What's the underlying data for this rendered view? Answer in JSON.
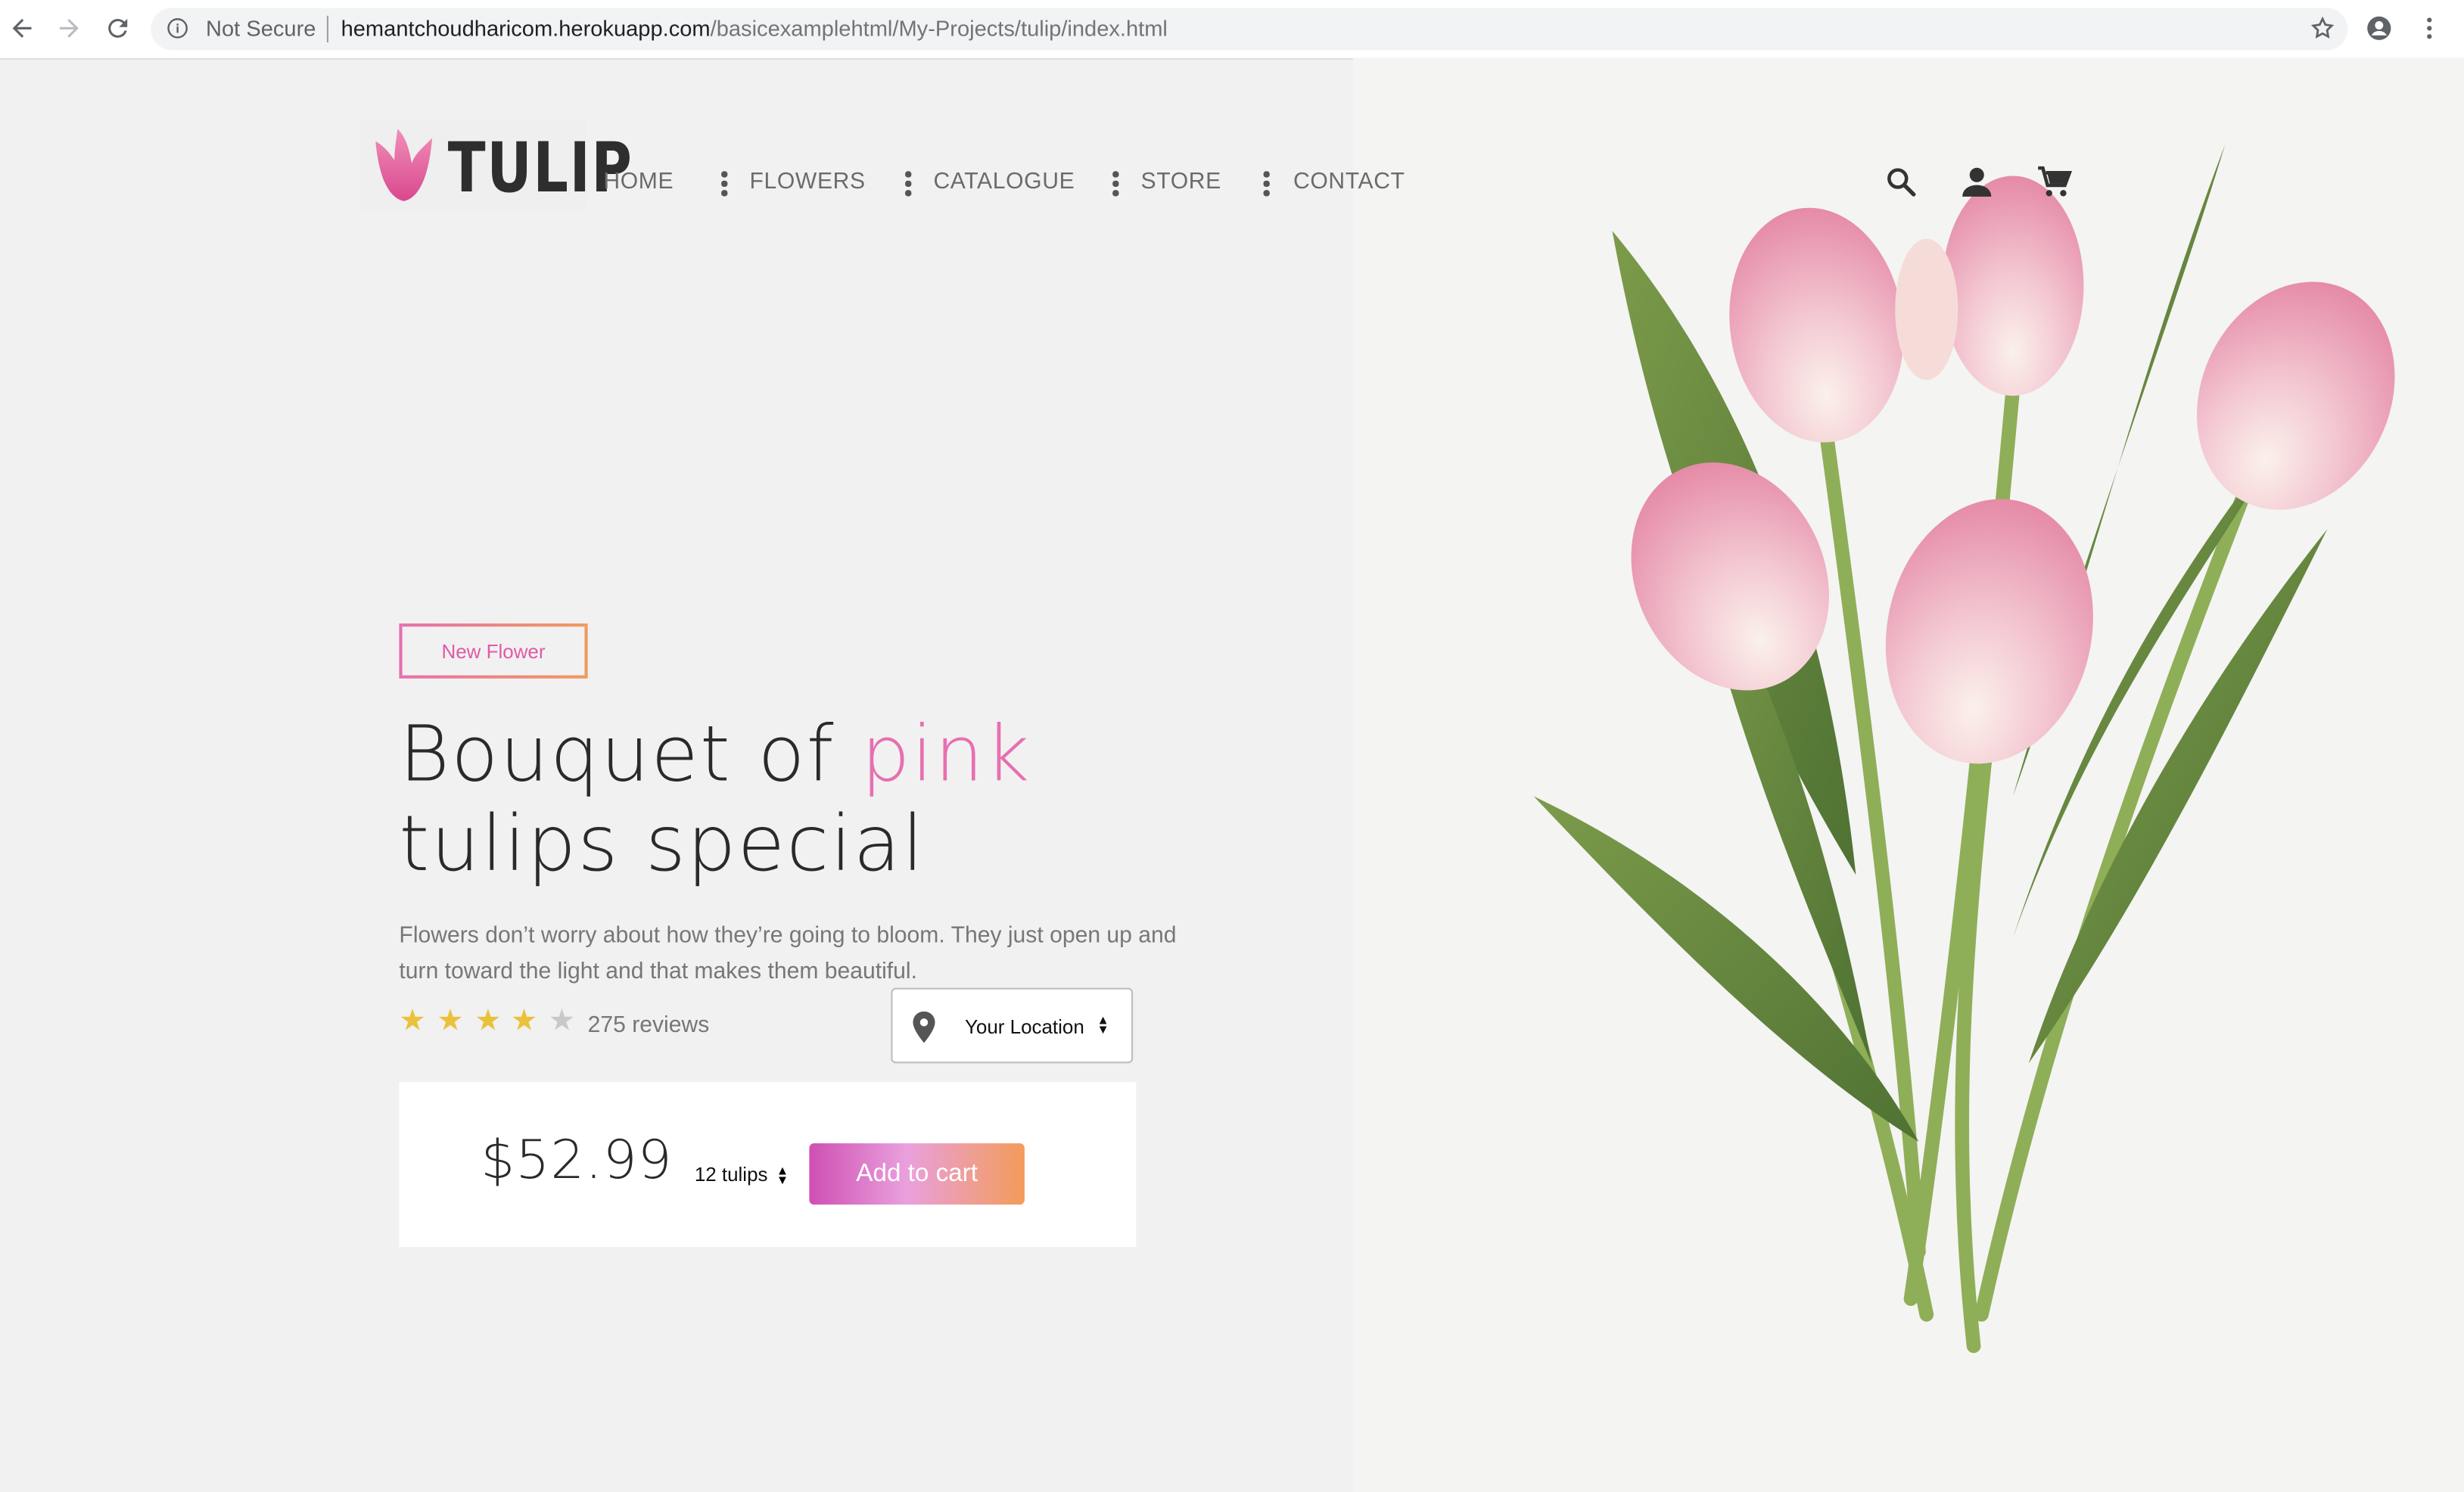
{
  "browser": {
    "security_label": "Not Secure",
    "url_host": "hemantchoudharicom.herokuapp.com",
    "url_path": "/basicexamplehtml/My-Projects/tulip/index.html"
  },
  "brand": {
    "name": "TULIP"
  },
  "nav": {
    "items": [
      {
        "label": "HOME"
      },
      {
        "label": "FLOWERS"
      },
      {
        "label": "CATALOGUE"
      },
      {
        "label": "STORE"
      },
      {
        "label": "CONTACT"
      }
    ]
  },
  "header_icons": [
    "search-icon",
    "user-icon",
    "cart-icon"
  ],
  "hero": {
    "badge": "New Flower",
    "title_part1": "Bouquet of ",
    "title_highlight": "pink",
    "title_line2": "tulips special",
    "description": "Flowers don’t worry about how they’re going to bloom. They just open up and turn toward the light and that makes them beautiful.",
    "rating": 4,
    "rating_max": 5,
    "reviews": "275 reviews",
    "location_label": "Your Location",
    "price": "$52.99",
    "quantity": "12 tulips",
    "add_to_cart": "Add to cart"
  },
  "colors": {
    "accent_pink": "#e76fb0",
    "star_gold": "#e9c23a",
    "star_empty": "#c8c8c8",
    "button_gradient_start": "#cf4fb3",
    "button_gradient_end": "#f39c5a"
  }
}
